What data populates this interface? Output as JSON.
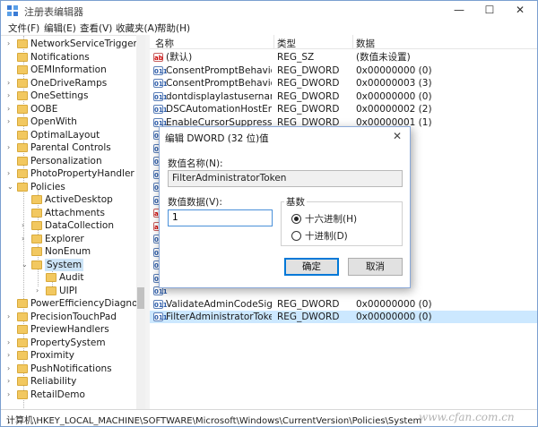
{
  "window": {
    "title": "注册表编辑器",
    "minimize_glyph": "—",
    "maximize_glyph": "☐",
    "close_glyph": "✕"
  },
  "menu": [
    "文件(F)",
    "编辑(E)",
    "查看(V)",
    "收藏夹(A)",
    "帮助(H)"
  ],
  "tree": {
    "items": [
      {
        "label": "NetworkServiceTriggers",
        "level": 0,
        "expander": "›"
      },
      {
        "label": "Notifications",
        "level": 0,
        "expander": ""
      },
      {
        "label": "OEMInformation",
        "level": 0,
        "expander": ""
      },
      {
        "label": "OneDriveRamps",
        "level": 0,
        "expander": "›"
      },
      {
        "label": "OneSettings",
        "level": 0,
        "expander": "›"
      },
      {
        "label": "OOBE",
        "level": 0,
        "expander": "›"
      },
      {
        "label": "OpenWith",
        "level": 0,
        "expander": "›"
      },
      {
        "label": "OptimalLayout",
        "level": 0,
        "expander": ""
      },
      {
        "label": "Parental Controls",
        "level": 0,
        "expander": "›"
      },
      {
        "label": "Personalization",
        "level": 0,
        "expander": ""
      },
      {
        "label": "PhotoPropertyHandler",
        "level": 0,
        "expander": "›"
      },
      {
        "label": "Policies",
        "level": 0,
        "expander": "⌄"
      },
      {
        "label": "ActiveDesktop",
        "level": 1,
        "expander": ""
      },
      {
        "label": "Attachments",
        "level": 1,
        "expander": ""
      },
      {
        "label": "DataCollection",
        "level": 1,
        "expander": "›"
      },
      {
        "label": "Explorer",
        "level": 1,
        "expander": "›"
      },
      {
        "label": "NonEnum",
        "level": 1,
        "expander": ""
      },
      {
        "label": "System",
        "level": 1,
        "expander": "⌄",
        "selected": true
      },
      {
        "label": "Audit",
        "level": 2,
        "expander": ""
      },
      {
        "label": "UIPI",
        "level": 2,
        "expander": "›"
      },
      {
        "label": "PowerEfficiencyDiagnostics",
        "level": 0,
        "expander": ""
      },
      {
        "label": "PrecisionTouchPad",
        "level": 0,
        "expander": "›"
      },
      {
        "label": "PreviewHandlers",
        "level": 0,
        "expander": ""
      },
      {
        "label": "PropertySystem",
        "level": 0,
        "expander": "›"
      },
      {
        "label": "Proximity",
        "level": 0,
        "expander": "›"
      },
      {
        "label": "PushNotifications",
        "level": 0,
        "expander": "›"
      },
      {
        "label": "Reliability",
        "level": 0,
        "expander": "›"
      },
      {
        "label": "RetailDemo",
        "level": 0,
        "expander": "›"
      }
    ]
  },
  "list": {
    "columns": {
      "name": "名称",
      "type": "类型",
      "data": "数据"
    },
    "rows": [
      {
        "icon": "ab",
        "name": "(默认)",
        "type": "REG_SZ",
        "data": "(数值未设置)"
      },
      {
        "icon": "bin",
        "name": "ConsentPromptBehaviorAdmin",
        "type": "REG_DWORD",
        "data": "0x00000000 (0)"
      },
      {
        "icon": "bin",
        "name": "ConsentPromptBehaviorUser",
        "type": "REG_DWORD",
        "data": "0x00000003 (3)"
      },
      {
        "icon": "bin",
        "name": "dontdisplaylastusername",
        "type": "REG_DWORD",
        "data": "0x00000000 (0)"
      },
      {
        "icon": "bin",
        "name": "DSCAutomationHostEnabled",
        "type": "REG_DWORD",
        "data": "0x00000002 (2)"
      },
      {
        "icon": "bin",
        "name": "EnableCursorSuppression",
        "type": "REG_DWORD",
        "data": "0x00000001 (1)"
      },
      {
        "icon": "bin",
        "name": "",
        "type": "",
        "data": ""
      },
      {
        "icon": "bin",
        "name": "",
        "type": "",
        "data": ""
      },
      {
        "icon": "bin",
        "name": "",
        "type": "",
        "data": ""
      },
      {
        "icon": "bin",
        "name": "",
        "type": "",
        "data": ""
      },
      {
        "icon": "bin",
        "name": "",
        "type": "",
        "data": ""
      },
      {
        "icon": "bin",
        "name": "",
        "type": "",
        "data": ""
      },
      {
        "icon": "ab",
        "name": "",
        "type": "",
        "data": ""
      },
      {
        "icon": "ab",
        "name": "",
        "type": "",
        "data": ""
      },
      {
        "icon": "bin",
        "name": "",
        "type": "",
        "data": ""
      },
      {
        "icon": "bin",
        "name": "",
        "type": "",
        "data": ""
      },
      {
        "icon": "bin",
        "name": "",
        "type": "",
        "data": ""
      },
      {
        "icon": "bin",
        "name": "",
        "type": "",
        "data": ""
      },
      {
        "icon": "bin",
        "name": "",
        "type": "",
        "data": ""
      },
      {
        "icon": "bin",
        "name": "ValidateAdminCodeSignatures",
        "type": "REG_DWORD",
        "data": "0x00000000 (0)"
      },
      {
        "icon": "bin",
        "name": "FilterAdministratorToken",
        "type": "REG_DWORD",
        "data": "0x00000000 (0)",
        "selected": true
      }
    ]
  },
  "dialog": {
    "title": "编辑 DWORD (32 位)值",
    "close_glyph": "✕",
    "value_name_label": "数值名称(N):",
    "value_name": "FilterAdministratorToken",
    "value_data_label": "数值数据(V):",
    "value_data": "1",
    "base_label": "基数",
    "radio_hex": "十六进制(H)",
    "radio_dec": "十进制(D)",
    "ok_label": "确定",
    "cancel_label": "取消"
  },
  "status": {
    "path": "计算机\\HKEY_LOCAL_MACHINE\\SOFTWARE\\Microsoft\\Windows\\CurrentVersion\\Policies\\System"
  },
  "watermark": "www.cfan.com.cn",
  "colors": {
    "selection": "#cce8ff",
    "folder": "#f2c860",
    "accent": "#0078d7"
  }
}
